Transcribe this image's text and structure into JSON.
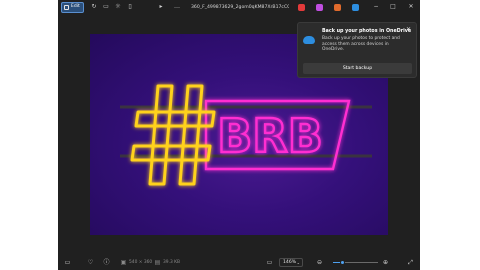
{
  "toolbar": {
    "edit_label": "Edit",
    "filename": "360_F_499873629_2gom0qKM87XrB17cCCZA...",
    "icons": [
      "rotate-icon",
      "crop-icon",
      "adjust-icon",
      "delete-icon",
      "slideshow-icon",
      "more-icon"
    ]
  },
  "notification": {
    "title": "Back up your photos in OneDrive",
    "body": "Back up your photos to protect and access them across devices in OneDrive.",
    "button": "Start backup",
    "close_glyph": "✕"
  },
  "image": {
    "text": "BRB",
    "hash": "#",
    "colors": {
      "neon_yellow": "#ffd21a",
      "neon_pink": "#ff2ed1",
      "background": "#34107a"
    }
  },
  "statusbar": {
    "dimensions": "540 × 360",
    "filesize": "39.3 KB",
    "zoom": "146%"
  },
  "colors": {
    "accent": "#4ea1f0",
    "app_bg": "#202020"
  }
}
